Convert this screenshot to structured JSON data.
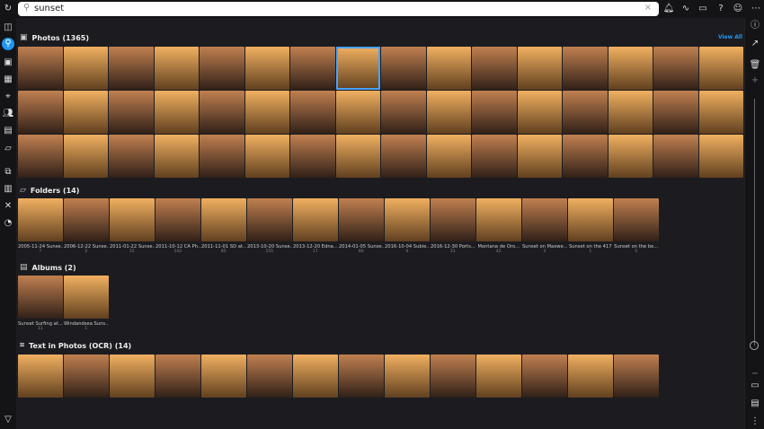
{
  "search": {
    "value": "sunset",
    "clear": "×"
  },
  "sections": {
    "photos": {
      "title": "Photos (1365)",
      "view_all": "View All",
      "count": 48
    },
    "folders": {
      "title": "Folders (14)",
      "items": [
        {
          "label": "2005-11-24 Sunse...",
          "count": "7"
        },
        {
          "label": "2006-12-22 Sunse...",
          "count": "2"
        },
        {
          "label": "2011-01-22 Sunse...",
          "count": "15"
        },
        {
          "label": "2011-10-12 CA Ph...",
          "count": "143"
        },
        {
          "label": "2011-11-01 SD at...",
          "count": "85"
        },
        {
          "label": "2013-10-20 Sunse...",
          "count": "155"
        },
        {
          "label": "2013-12-20 Edna...",
          "count": "17"
        },
        {
          "label": "2014-01-05 Sunse...",
          "count": "80"
        },
        {
          "label": "2016-10-04 Subie...",
          "count": "4"
        },
        {
          "label": "2016-12-30 Ports...",
          "count": "31"
        },
        {
          "label": "Montana de Oro...",
          "count": "42"
        },
        {
          "label": "Sunset on Maxwe...",
          "count": "3"
        },
        {
          "label": "Sunset on the 417",
          "count": "1"
        },
        {
          "label": "Sunset on the be...",
          "count": "5"
        }
      ]
    },
    "albums": {
      "title": "Albums (2)",
      "items": [
        {
          "label": "Sunset Surfing at...",
          "count": "11"
        },
        {
          "label": "Windandsea Suns...",
          "count": "1"
        }
      ]
    },
    "ocr": {
      "title": "Text in Photos (OCR) (14)",
      "count": 14
    }
  },
  "colors": {
    "accent": "#2196f3",
    "background": "#1c1c20"
  }
}
